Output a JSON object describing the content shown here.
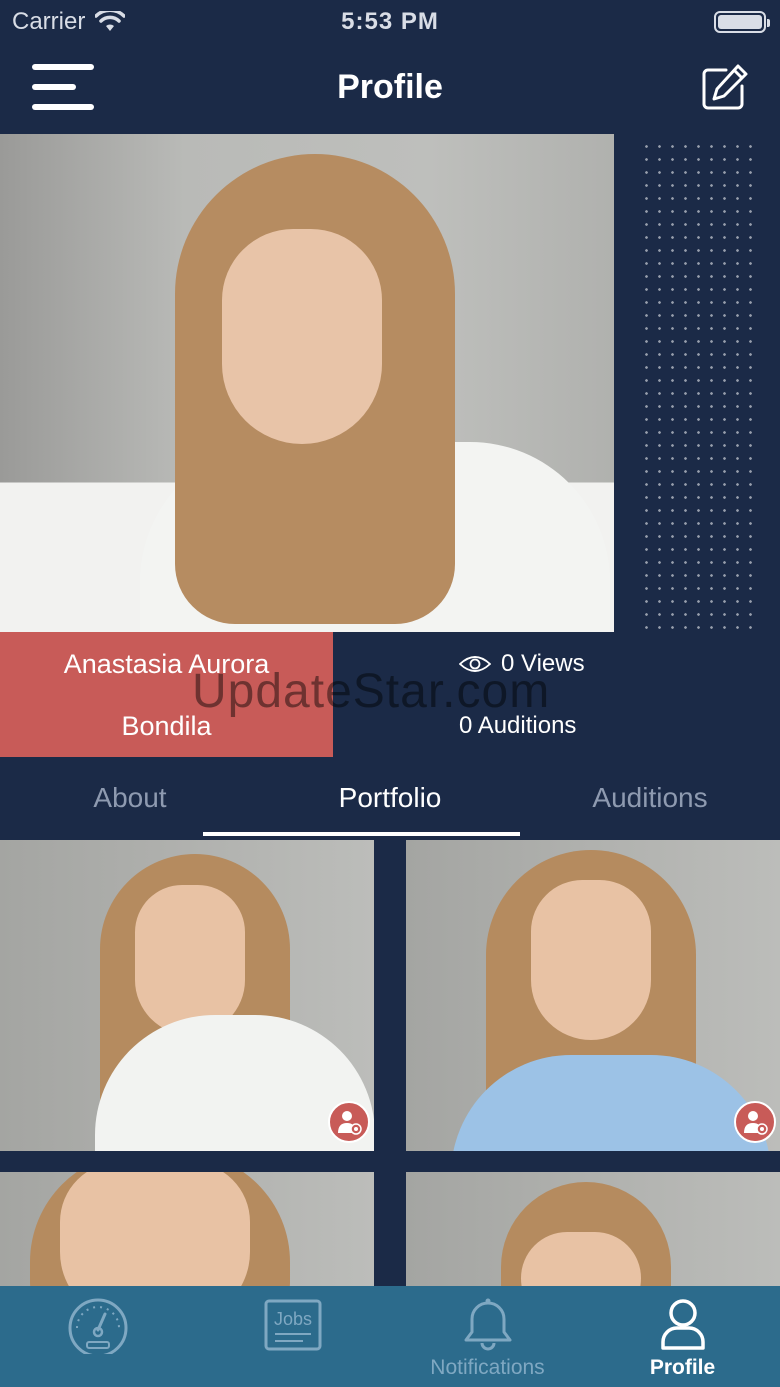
{
  "status_bar": {
    "carrier": "Carrier",
    "time": "5:53 PM"
  },
  "header": {
    "title": "Profile"
  },
  "profile": {
    "name_line1": "Anastasia Aurora",
    "name_line2": "Bondila",
    "views": "0 Views",
    "auditions": "0 Auditions"
  },
  "watermark": "UpdateStar.com",
  "tabs": [
    {
      "label": "About",
      "active": false
    },
    {
      "label": "Portfolio",
      "active": true
    },
    {
      "label": "Auditions",
      "active": false
    }
  ],
  "portfolio": [
    {
      "badge": "photo-badge-icon"
    },
    {
      "badge": "photo-badge-icon"
    },
    {
      "badge": null
    },
    {
      "badge": null
    }
  ],
  "tab_bar": {
    "dashboard_label": "",
    "jobs_icon_text": "Jobs",
    "notifications_label": "Notifications",
    "profile_label": "Profile"
  },
  "colors": {
    "background": "#1b2a47",
    "accent_red": "#c85b58",
    "tab_bar": "#2c6b8c",
    "inactive_tab": "#8e9ab0"
  }
}
